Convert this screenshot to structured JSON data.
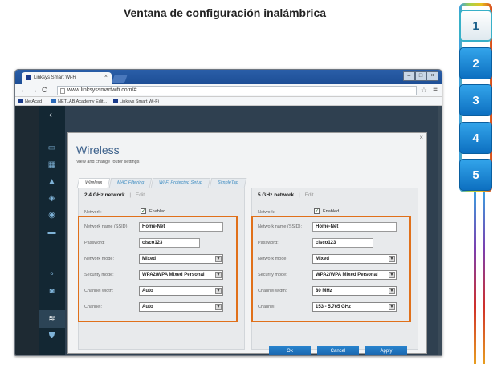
{
  "slide_title": "Ventana de configuración inalámbrica",
  "steps": [
    "1",
    "2",
    "3",
    "4",
    "5"
  ],
  "active_step": "1",
  "browser": {
    "tab_title": "Linksys Smart Wi-Fi",
    "tab_close": "×",
    "window_controls": [
      "–",
      "□",
      "×"
    ],
    "url": "www.linksyssmartwifi.com/#",
    "bookmarks": [
      "NetAcad",
      "NETLAB Academy Edit...",
      "Linksys Smart Wi-Fi"
    ],
    "star_icon": "☆",
    "menu_icon": "≡"
  },
  "dialog": {
    "title": "Wireless",
    "subtitle": "View and change router settings",
    "close": "×",
    "tabs": [
      "Wireless",
      "MAC Filtering",
      "Wi-Fi Protected Setup",
      "SimpleTap"
    ],
    "active_tab": "Wireless",
    "labels": {
      "network": "Network:",
      "ssid": "Network name (SSID):",
      "password": "Password:",
      "mode": "Network mode:",
      "security": "Security mode:",
      "width": "Channel width:",
      "channel": "Channel:",
      "enabled": "Enabled",
      "edit": "Edit",
      "sep": "|"
    },
    "band_24": {
      "header": "2.4 GHz network",
      "ssid": "Home-Net",
      "password": "cisco123",
      "mode": "Mixed",
      "security": "WPA2/WPA Mixed Personal",
      "width": "Auto",
      "channel": "Auto"
    },
    "band_5": {
      "header": "5 GHz network",
      "ssid": "Home-Net",
      "password": "cisco123",
      "mode": "Mixed",
      "security": "WPA2/WPA Mixed Personal",
      "width": "80 MHz",
      "channel": "153 - 5.765 GHz"
    },
    "buttons": {
      "ok": "Ok",
      "cancel": "Cancel",
      "apply": "Apply"
    }
  },
  "colors": {
    "highlight": "#e0701a",
    "accent": "#3a5f8a",
    "button": "#1f74bf"
  }
}
